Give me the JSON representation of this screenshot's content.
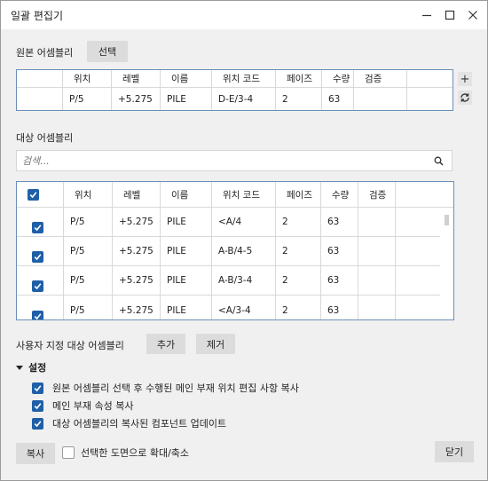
{
  "window": {
    "title": "일괄 편집기"
  },
  "source": {
    "label": "원본 어셈블리",
    "select_button": "선택",
    "columns": [
      "위치",
      "레벨",
      "이름",
      "위치 코드",
      "페이즈",
      "수량",
      "검증"
    ],
    "rows": [
      {
        "pos": "P/5",
        "level": "+5.275",
        "name": "PILE",
        "code": "D-E/3-4",
        "phase": "2",
        "qty": "63",
        "check": ""
      }
    ],
    "add_icon": "+",
    "refresh_icon": "refresh-icon"
  },
  "target": {
    "label": "대상 어셈블리",
    "search_placeholder": "검색...",
    "columns": [
      "위치",
      "레벨",
      "이름",
      "위치 코드",
      "페이즈",
      "수량",
      "검증"
    ],
    "rows": [
      {
        "checked": true,
        "pos": "P/5",
        "level": "+5.275",
        "name": "PILE",
        "code": "<A/4",
        "phase": "2",
        "qty": "63",
        "check": ""
      },
      {
        "checked": true,
        "pos": "P/5",
        "level": "+5.275",
        "name": "PILE",
        "code": "A-B/4-5",
        "phase": "2",
        "qty": "63",
        "check": ""
      },
      {
        "checked": true,
        "pos": "P/5",
        "level": "+5.275",
        "name": "PILE",
        "code": "A-B/3-4",
        "phase": "2",
        "qty": "63",
        "check": ""
      },
      {
        "checked": true,
        "pos": "P/5",
        "level": "+5.275",
        "name": "PILE",
        "code": "<A/3-4",
        "phase": "2",
        "qty": "63",
        "check": ""
      }
    ]
  },
  "custom": {
    "label": "사용자 지정 대상 어셈블리",
    "add_button": "추가",
    "remove_button": "제거"
  },
  "settings": {
    "label": "설정",
    "options": [
      "원본 어셈블리 선택 후 수행된 메인 부재 위치 편집 사항 복사",
      "메인 부재 속성 복사",
      "대상 어셈블리의 복사된 컴포넌트 업데이트"
    ]
  },
  "footer": {
    "copy_button": "복사",
    "zoom_label": "선택한 도면으로 확대/축소",
    "close_button": "닫기"
  },
  "colors": {
    "accent": "#1f5fa8",
    "grid_border": "#6b8fb8"
  }
}
